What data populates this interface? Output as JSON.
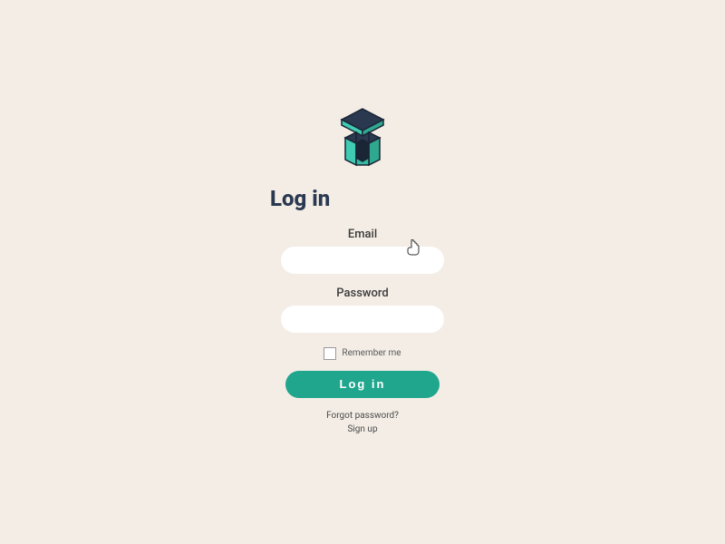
{
  "title": "Log in",
  "fields": {
    "email": {
      "label": "Email",
      "value": ""
    },
    "password": {
      "label": "Password",
      "value": ""
    }
  },
  "remember": {
    "label": "Remember me",
    "checked": false
  },
  "buttons": {
    "login": "Log in"
  },
  "links": {
    "forgot": "Forgot password?",
    "signup": "Sign up"
  },
  "colors": {
    "background": "#f3ede5",
    "accent": "#1fa68d",
    "titleDark": "#2a3850",
    "logoTeal": "#3fccb2",
    "logoDark": "#2a3850"
  }
}
